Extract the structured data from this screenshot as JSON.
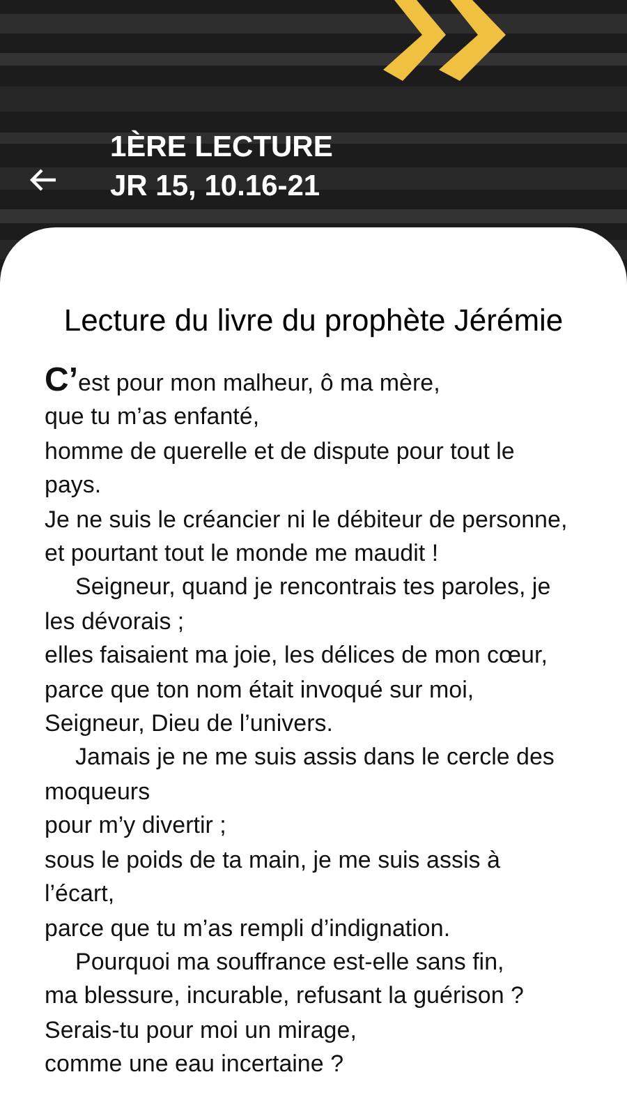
{
  "header": {
    "title_lines": [
      "1ÈRE LECTURE",
      "JR 15, 10.16-21"
    ]
  },
  "reading": {
    "heading": "Lecture du livre du prophète Jérémie",
    "verses": [
      {
        "kind": "first",
        "text": "C’est pour mon malheur, ô ma mère,"
      },
      {
        "kind": "line",
        "text": "que tu m’as enfanté,"
      },
      {
        "kind": "line",
        "text": "homme de querelle et de dispute pour tout le pays."
      },
      {
        "kind": "line",
        "text": "Je ne suis le créancier ni le débiteur de personne,"
      },
      {
        "kind": "line",
        "text": "et pourtant tout le monde me maudit !"
      },
      {
        "kind": "indent",
        "text": "Seigneur, quand je rencontrais tes paroles, je les dévorais ;"
      },
      {
        "kind": "line",
        "text": "elles faisaient ma joie, les délices de mon cœur,"
      },
      {
        "kind": "line",
        "text": "parce que ton nom était invoqué sur moi,"
      },
      {
        "kind": "line",
        "text": "Seigneur, Dieu de l’univers."
      },
      {
        "kind": "indent",
        "text": "Jamais je ne me suis assis dans le cercle des moqueurs"
      },
      {
        "kind": "line",
        "text": "pour m’y divertir ;"
      },
      {
        "kind": "line",
        "text": "sous le poids de ta main, je me suis assis à l’écart,"
      },
      {
        "kind": "line",
        "text": "parce que tu m’as rempli d’indignation."
      },
      {
        "kind": "indent",
        "text": "Pourquoi ma souffrance est-elle sans fin,"
      },
      {
        "kind": "line",
        "text": "ma blessure, incurable, refusant la guérison ?"
      },
      {
        "kind": "line",
        "text": "Serais-tu pour moi un mirage,"
      },
      {
        "kind": "line",
        "text": "comme une eau incertaine ?"
      }
    ]
  }
}
